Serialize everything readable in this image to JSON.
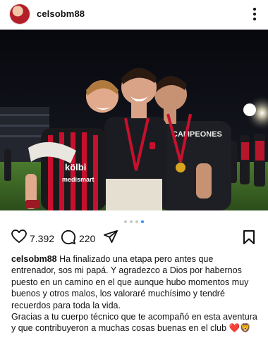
{
  "header": {
    "username": "celsobm88"
  },
  "post": {
    "carousel_total": 4,
    "carousel_active": 4,
    "shirt_text": "CAMPEONES",
    "sponsor_text": "kölbi",
    "sponsor_text2": "medismart"
  },
  "actions": {
    "likes": "7.392",
    "comments": "220"
  },
  "caption": {
    "username": "celsobm88",
    "text": " Ha finalizado una etapa pero antes que entrenador, sos mi papá. Y agradezco a Dios por habernos puesto en un camino en el que aunque hubo momentos muy buenos y otros malos, los valoraré muchísimo y tendré recuerdos para toda la vida.\nGracias a tu cuerpo técnico que te acompañó en esta aventura y que contribuyeron a muchas cosas buenas en el club ❤️🦁"
  },
  "colors": {
    "accent_blue": "#3897f0",
    "club_red": "#c8102e"
  }
}
